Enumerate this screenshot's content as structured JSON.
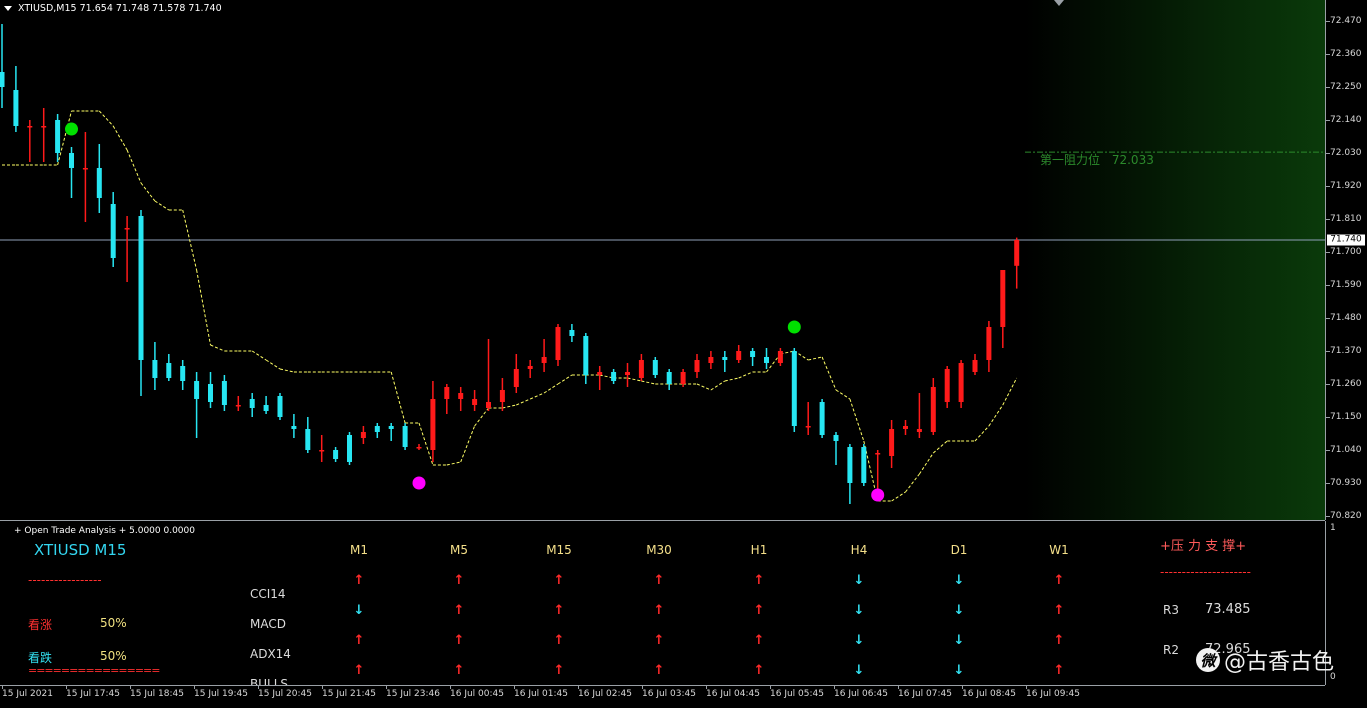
{
  "header": {
    "symbol_tf": "XTIUSD,M15",
    "ohlc": "71.654 71.748 71.578 71.740"
  },
  "colors": {
    "bull_candle": "#ff1a1a",
    "bear_candle": "#27e6f2",
    "buy_dot": "#00e000",
    "sell_dot": "#ff00ff",
    "stop_line": "#ffff66",
    "resistance_line": "#2c8a2c",
    "up_arrow": "#ff2a2a",
    "down_arrow": "#33e0f0"
  },
  "price_axis": {
    "labels": [
      "72.470",
      "72.360",
      "72.250",
      "72.140",
      "72.030",
      "71.920",
      "71.810",
      "71.700",
      "71.590",
      "71.480",
      "71.370",
      "71.260",
      "71.150",
      "71.040",
      "70.930",
      "70.820"
    ],
    "current_price": "71.740"
  },
  "resistance": {
    "label": "第一阻力位",
    "value": "72.033",
    "price": 72.033
  },
  "chart_data": {
    "type": "candlestick",
    "symbol": "XTIUSD",
    "timeframe": "M15",
    "ylim": [
      70.8,
      72.5
    ],
    "candles": [
      {
        "o": 72.3,
        "h": 72.46,
        "l": 72.18,
        "c": 72.25
      },
      {
        "o": 72.24,
        "h": 72.32,
        "l": 72.1,
        "c": 72.12
      },
      {
        "o": 72.12,
        "h": 72.14,
        "l": 72.0,
        "c": 72.12
      },
      {
        "o": 72.12,
        "h": 72.18,
        "l": 72.0,
        "c": 72.12
      },
      {
        "o": 72.14,
        "h": 72.16,
        "l": 72.0,
        "c": 72.03
      },
      {
        "o": 72.03,
        "h": 72.05,
        "l": 71.88,
        "c": 71.98
      },
      {
        "o": 71.98,
        "h": 72.1,
        "l": 71.8,
        "c": 71.98
      },
      {
        "o": 71.98,
        "h": 72.06,
        "l": 71.83,
        "c": 71.88
      },
      {
        "o": 71.86,
        "h": 71.9,
        "l": 71.65,
        "c": 71.68
      },
      {
        "o": 71.78,
        "h": 71.82,
        "l": 71.6,
        "c": 71.78
      },
      {
        "o": 71.82,
        "h": 71.84,
        "l": 71.22,
        "c": 71.34
      },
      {
        "o": 71.34,
        "h": 71.4,
        "l": 71.24,
        "c": 71.28
      },
      {
        "o": 71.33,
        "h": 71.36,
        "l": 71.27,
        "c": 71.28
      },
      {
        "o": 71.32,
        "h": 71.34,
        "l": 71.24,
        "c": 71.27
      },
      {
        "o": 71.27,
        "h": 71.3,
        "l": 71.08,
        "c": 71.21
      },
      {
        "o": 71.26,
        "h": 71.3,
        "l": 71.18,
        "c": 71.2
      },
      {
        "o": 71.27,
        "h": 71.29,
        "l": 71.17,
        "c": 71.19
      },
      {
        "o": 71.19,
        "h": 71.22,
        "l": 71.17,
        "c": 71.19
      },
      {
        "o": 71.21,
        "h": 71.23,
        "l": 71.15,
        "c": 71.18
      },
      {
        "o": 71.19,
        "h": 71.22,
        "l": 71.16,
        "c": 71.17
      },
      {
        "o": 71.22,
        "h": 71.23,
        "l": 71.14,
        "c": 71.15
      },
      {
        "o": 71.12,
        "h": 71.16,
        "l": 71.08,
        "c": 71.11
      },
      {
        "o": 71.11,
        "h": 71.15,
        "l": 71.03,
        "c": 71.04
      },
      {
        "o": 71.04,
        "h": 71.09,
        "l": 71.0,
        "c": 71.04
      },
      {
        "o": 71.04,
        "h": 71.05,
        "l": 71.0,
        "c": 71.01
      },
      {
        "o": 71.09,
        "h": 71.1,
        "l": 70.99,
        "c": 71.0
      },
      {
        "o": 71.08,
        "h": 71.12,
        "l": 71.06,
        "c": 71.1
      },
      {
        "o": 71.12,
        "h": 71.13,
        "l": 71.08,
        "c": 71.1
      },
      {
        "o": 71.12,
        "h": 71.13,
        "l": 71.07,
        "c": 71.11
      },
      {
        "o": 71.12,
        "h": 71.13,
        "l": 71.04,
        "c": 71.05
      },
      {
        "o": 71.05,
        "h": 71.06,
        "l": 71.04,
        "c": 71.05
      },
      {
        "o": 71.04,
        "h": 71.27,
        "l": 71.0,
        "c": 71.21
      },
      {
        "o": 71.21,
        "h": 71.26,
        "l": 71.16,
        "c": 71.25
      },
      {
        "o": 71.21,
        "h": 71.25,
        "l": 71.17,
        "c": 71.23
      },
      {
        "o": 71.19,
        "h": 71.24,
        "l": 71.17,
        "c": 71.21
      },
      {
        "o": 71.18,
        "h": 71.41,
        "l": 71.17,
        "c": 71.2
      },
      {
        "o": 71.2,
        "h": 71.28,
        "l": 71.17,
        "c": 71.24
      },
      {
        "o": 71.25,
        "h": 71.36,
        "l": 71.23,
        "c": 71.31
      },
      {
        "o": 71.31,
        "h": 71.34,
        "l": 71.28,
        "c": 71.32
      },
      {
        "o": 71.33,
        "h": 71.41,
        "l": 71.3,
        "c": 71.35
      },
      {
        "o": 71.34,
        "h": 71.46,
        "l": 71.32,
        "c": 71.45
      },
      {
        "o": 71.44,
        "h": 71.46,
        "l": 71.4,
        "c": 71.42
      },
      {
        "o": 71.42,
        "h": 71.43,
        "l": 71.26,
        "c": 71.29
      },
      {
        "o": 71.29,
        "h": 71.32,
        "l": 71.24,
        "c": 71.3
      },
      {
        "o": 71.3,
        "h": 71.31,
        "l": 71.26,
        "c": 71.27
      },
      {
        "o": 71.29,
        "h": 71.33,
        "l": 71.25,
        "c": 71.3
      },
      {
        "o": 71.28,
        "h": 71.36,
        "l": 71.27,
        "c": 71.34
      },
      {
        "o": 71.34,
        "h": 71.35,
        "l": 71.28,
        "c": 71.29
      },
      {
        "o": 71.3,
        "h": 71.31,
        "l": 71.24,
        "c": 71.26
      },
      {
        "o": 71.26,
        "h": 71.31,
        "l": 71.25,
        "c": 71.3
      },
      {
        "o": 71.3,
        "h": 71.36,
        "l": 71.28,
        "c": 71.34
      },
      {
        "o": 71.33,
        "h": 71.37,
        "l": 71.31,
        "c": 71.35
      },
      {
        "o": 71.35,
        "h": 71.37,
        "l": 71.3,
        "c": 71.34
      },
      {
        "o": 71.34,
        "h": 71.39,
        "l": 71.33,
        "c": 71.37
      },
      {
        "o": 71.37,
        "h": 71.38,
        "l": 71.32,
        "c": 71.35
      },
      {
        "o": 71.35,
        "h": 71.38,
        "l": 71.31,
        "c": 71.33
      },
      {
        "o": 71.33,
        "h": 71.38,
        "l": 71.32,
        "c": 71.37
      },
      {
        "o": 71.37,
        "h": 71.38,
        "l": 71.1,
        "c": 71.12
      },
      {
        "o": 71.12,
        "h": 71.2,
        "l": 71.09,
        "c": 71.12
      },
      {
        "o": 71.2,
        "h": 71.21,
        "l": 71.08,
        "c": 71.09
      },
      {
        "o": 71.09,
        "h": 71.1,
        "l": 70.99,
        "c": 71.07
      },
      {
        "o": 71.05,
        "h": 71.06,
        "l": 70.86,
        "c": 70.93
      },
      {
        "o": 71.05,
        "h": 71.06,
        "l": 70.92,
        "c": 70.93
      },
      {
        "o": 71.03,
        "h": 71.04,
        "l": 70.9,
        "c": 71.03
      },
      {
        "o": 71.02,
        "h": 71.14,
        "l": 70.98,
        "c": 71.11
      },
      {
        "o": 71.11,
        "h": 71.14,
        "l": 71.09,
        "c": 71.12
      },
      {
        "o": 71.1,
        "h": 71.23,
        "l": 71.08,
        "c": 71.11
      },
      {
        "o": 71.1,
        "h": 71.28,
        "l": 71.09,
        "c": 71.25
      },
      {
        "o": 71.2,
        "h": 71.32,
        "l": 71.18,
        "c": 71.31
      },
      {
        "o": 71.2,
        "h": 71.34,
        "l": 71.18,
        "c": 71.33
      },
      {
        "o": 71.3,
        "h": 71.36,
        "l": 71.29,
        "c": 71.34
      },
      {
        "o": 71.34,
        "h": 71.47,
        "l": 71.3,
        "c": 71.45
      },
      {
        "o": 71.45,
        "h": 71.64,
        "l": 71.38,
        "c": 71.64
      },
      {
        "o": 71.654,
        "h": 71.748,
        "l": 71.578,
        "c": 71.74
      }
    ],
    "stop_line": [
      71.99,
      71.99,
      71.99,
      71.99,
      71.99,
      72.17,
      72.17,
      72.17,
      72.12,
      72.04,
      71.93,
      71.87,
      71.84,
      71.84,
      71.64,
      71.39,
      71.37,
      71.37,
      71.37,
      71.34,
      71.31,
      71.3,
      71.3,
      71.3,
      71.3,
      71.3,
      71.3,
      71.3,
      71.3,
      71.13,
      71.13,
      70.99,
      70.99,
      71.0,
      71.12,
      71.18,
      71.18,
      71.19,
      71.21,
      71.23,
      71.26,
      71.29,
      71.29,
      71.29,
      71.28,
      71.28,
      71.27,
      71.26,
      71.26,
      71.26,
      71.26,
      71.24,
      71.27,
      71.28,
      71.3,
      71.3,
      71.36,
      71.37,
      71.34,
      71.35,
      71.24,
      71.21,
      71.07,
      70.87,
      70.87,
      70.9,
      70.96,
      71.03,
      71.07,
      71.07,
      71.07,
      71.12,
      71.19,
      71.28
    ],
    "buy_signals": [
      {
        "index": 5,
        "price": 72.11
      },
      {
        "index": 57,
        "price": 71.45
      }
    ],
    "sell_signals": [
      {
        "index": 30,
        "price": 70.93
      },
      {
        "index": 63,
        "price": 70.89
      }
    ]
  },
  "time_axis": [
    "15 Jul 2021",
    "15 Jul 17:45",
    "15 Jul 18:45",
    "15 Jul 19:45",
    "15 Jul 20:45",
    "15 Jul 21:45",
    "15 Jul 23:46",
    "16 Jul 00:45",
    "16 Jul 01:45",
    "16 Jul 02:45",
    "16 Jul 03:45",
    "16 Jul 04:45",
    "16 Jul 05:45",
    "16 Jul 06:45",
    "16 Jul 07:45",
    "16 Jul 08:45",
    "16 Jul 09:45"
  ],
  "analysis": {
    "title": "+ Open Trade Analysis + 5.0000 0.0000",
    "symbol_tf": "XTIUSD  M15",
    "divider_top": "-----------------",
    "bull_label": "看涨",
    "bull_pct": "50%",
    "bear_label": "看跌",
    "bear_pct": "50%",
    "divider_bottom": "================",
    "timeframes": [
      "M1",
      "M5",
      "M15",
      "M30",
      "H1",
      "H4",
      "D1",
      "W1"
    ],
    "rows": [
      {
        "name": "CCI14",
        "arrows": [
          "up",
          "up",
          "up",
          "up",
          "up",
          "down",
          "down",
          "up"
        ]
      },
      {
        "name": "MACD",
        "arrows": [
          "down",
          "up",
          "up",
          "up",
          "up",
          "down",
          "down",
          "up"
        ]
      },
      {
        "name": "ADX14",
        "arrows": [
          "up",
          "up",
          "up",
          "up",
          "up",
          "down",
          "down",
          "up"
        ]
      },
      {
        "name": "BULLS",
        "arrows": [
          "up",
          "up",
          "up",
          "up",
          "up",
          "down",
          "down",
          "up"
        ]
      }
    ],
    "sr_title": "+压 力 支 撑+",
    "sr_divider": "---------------------",
    "levels": [
      {
        "name": "R3",
        "value": "73.485"
      },
      {
        "name": "R2",
        "value": "72.965"
      }
    ],
    "sub_axis_top": "1",
    "sub_axis_bottom": "0"
  },
  "watermark": {
    "icon": "微",
    "text": "@古香古色"
  }
}
